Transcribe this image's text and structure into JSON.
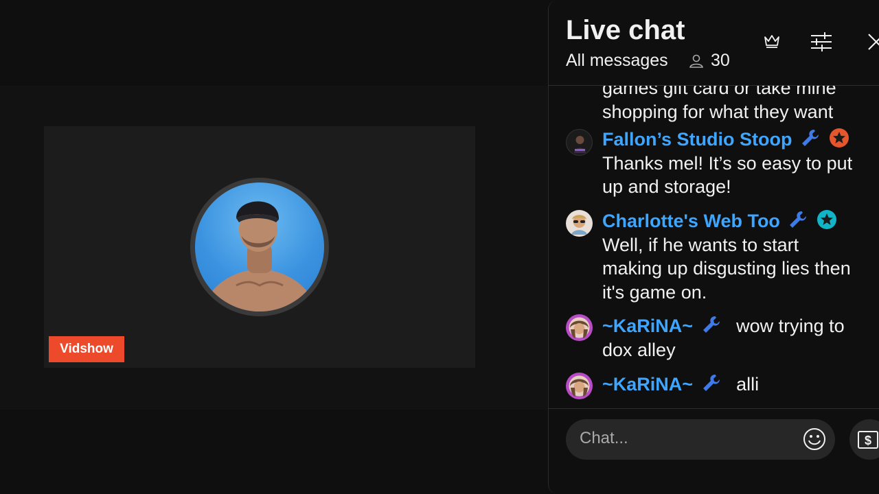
{
  "stream": {
    "badge_label": "Vidshow"
  },
  "chat": {
    "title": "Live chat",
    "filter_label": "All messages",
    "viewer_count": "30",
    "input_placeholder": "Chat...",
    "messages": [
      {
        "author": "",
        "lines": [
          "games gift card or take mine",
          "shopping for what they want"
        ]
      },
      {
        "author": "Fallon’s Studio Stoop",
        "badge_color": "#e5562d",
        "lines": [
          "Thanks mel! It’s so easy to put",
          "up and storage!"
        ]
      },
      {
        "author": "Charlotte's Web Too",
        "badge_color": "#12b4c8",
        "lines": [
          "Well, if he wants to start",
          "making up disgusting lies then",
          "it's game on."
        ]
      },
      {
        "author": "~KaRiNA~",
        "inline_text": "wow trying to",
        "lines": [
          "dox alley"
        ]
      },
      {
        "author": "~KaRiNA~",
        "inline_text": "alli",
        "lines": []
      }
    ]
  },
  "colors": {
    "author": "#3ea6ff",
    "badge_red": "#ec4a2a",
    "moderator_wrench": "#3e7be8"
  }
}
